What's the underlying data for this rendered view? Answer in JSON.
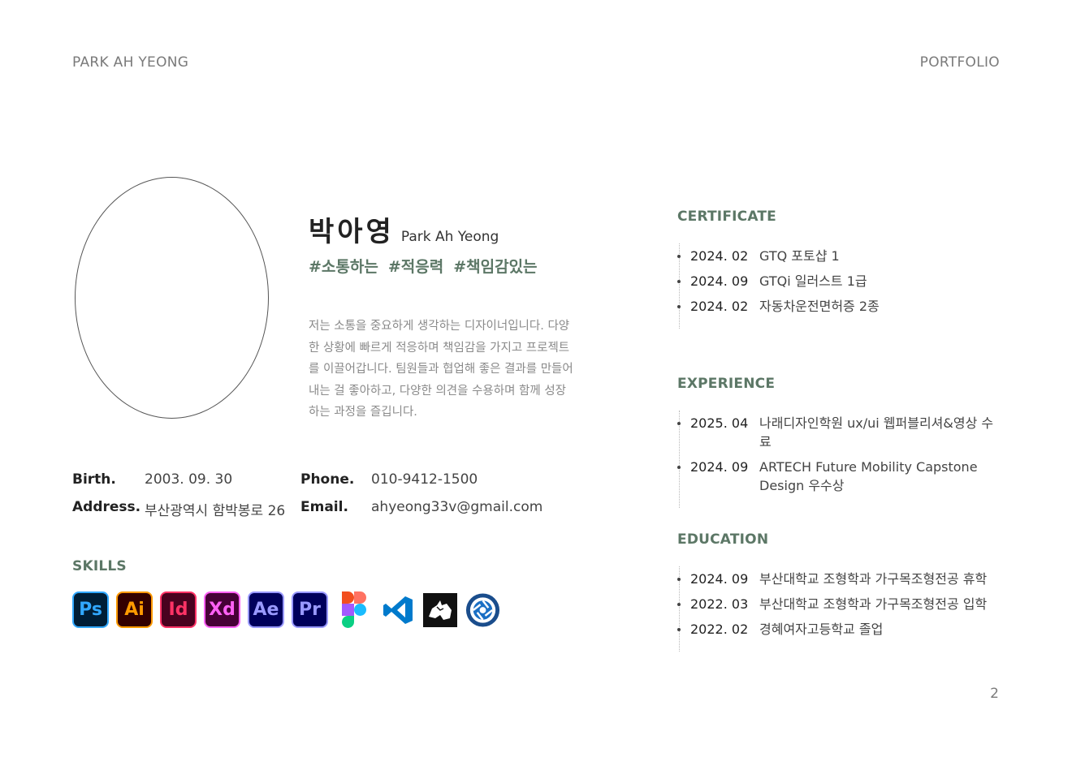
{
  "header": {
    "left": "PARK AH YEONG",
    "right": "PORTFOLIO"
  },
  "page_number": "2",
  "profile": {
    "name_ko": "박아영",
    "name_en": "Park Ah Yeong",
    "tags": [
      "#소통하는",
      "#적응력",
      "#책임감있는"
    ],
    "intro_lines": [
      "저는 소통을 중요하게 생각하는 디자이너입니다. 다양",
      "한 상황에 빠르게 적응하며 책임감을 가지고 프로젝트",
      "를 이끌어갑니다. 팀원들과 협업해 좋은 결과를 만들어",
      "내는 걸 좋아하고, 다양한 의견을 수용하며 함께 성장",
      "하는 과정을 즐깁니다."
    ]
  },
  "info": {
    "birth_label": "Birth.",
    "birth": "2003. 09. 30",
    "address_label": "Address.",
    "address": "부산광역시 함박봉로 26",
    "phone_label": "Phone.",
    "phone": "010-9412-1500",
    "email_label": "Email.",
    "email": "ahyeong33v@gmail.com"
  },
  "skills": {
    "title": "SKILLS",
    "items": [
      {
        "label": "Ps",
        "icon": "photoshop-icon"
      },
      {
        "label": "Ai",
        "icon": "illustrator-icon"
      },
      {
        "label": "Id",
        "icon": "indesign-icon"
      },
      {
        "label": "Xd",
        "icon": "xd-icon"
      },
      {
        "label": "Ae",
        "icon": "after-effects-icon"
      },
      {
        "label": "Pr",
        "icon": "premiere-icon"
      },
      {
        "label": "",
        "icon": "figma-icon"
      },
      {
        "label": "",
        "icon": "vscode-icon"
      },
      {
        "label": "",
        "icon": "rhino-icon"
      },
      {
        "label": "",
        "icon": "keyshot-icon"
      }
    ]
  },
  "certificate": {
    "title": "CERTIFICATE",
    "entries": [
      {
        "date": "2024. 02",
        "desc": "GTQ 포토샵 1"
      },
      {
        "date": "2024. 09",
        "desc": "GTQi 일러스트 1급"
      },
      {
        "date": "2024. 02",
        "desc": "자동차운전면허증 2종"
      }
    ]
  },
  "experience": {
    "title": "EXPERIENCE",
    "entries": [
      {
        "date": "2025. 04",
        "desc": "나래디자인학원 ux/ui 웹퍼블리셔&영상 수료"
      },
      {
        "date": "2024. 09",
        "desc": "ARTECH Future Mobility Capstone Design 우수상"
      }
    ]
  },
  "education": {
    "title": "EDUCATION",
    "entries": [
      {
        "date": "2024. 09",
        "desc": "부산대학교 조형학과 가구목조형전공 휴학"
      },
      {
        "date": "2022. 03",
        "desc": "부산대학교 조형학과 가구목조형전공 입학"
      },
      {
        "date": "2022. 02",
        "desc": "경혜여자고등학교 졸업"
      }
    ]
  }
}
